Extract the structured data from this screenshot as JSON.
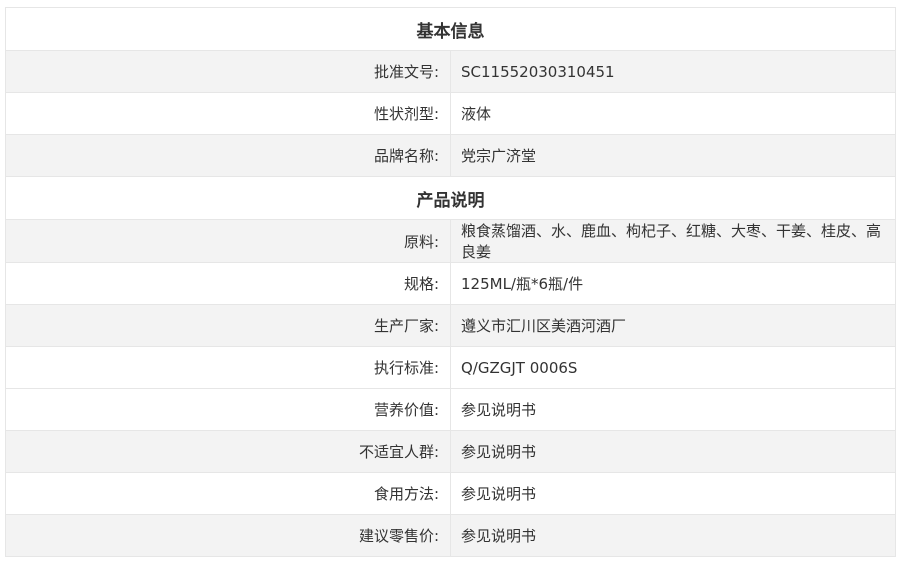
{
  "sections": [
    {
      "title": "基本信息",
      "rows": [
        {
          "label": "批准文号:",
          "value": "SC11552030310451"
        },
        {
          "label": "性状剂型:",
          "value": "液体"
        },
        {
          "label": "品牌名称:",
          "value": "党宗广济堂"
        }
      ]
    },
    {
      "title": "产品说明",
      "rows": [
        {
          "label": "原料:",
          "value": "粮食蒸馏酒、水、鹿血、枸杞子、红糖、大枣、干姜、桂皮、高良姜"
        },
        {
          "label": "规格:",
          "value": "125ML/瓶*6瓶/件"
        },
        {
          "label": "生产厂家:",
          "value": "遵义市汇川区美酒河酒厂"
        },
        {
          "label": "执行标准:",
          "value": "Q/GZGJT 0006S"
        },
        {
          "label": "营养价值:",
          "value": "参见说明书"
        },
        {
          "label": "不适宜人群:",
          "value": "参见说明书"
        },
        {
          "label": "食用方法:",
          "value": "参见说明书"
        },
        {
          "label": "建议零售价:",
          "value": "参见说明书"
        }
      ]
    }
  ]
}
